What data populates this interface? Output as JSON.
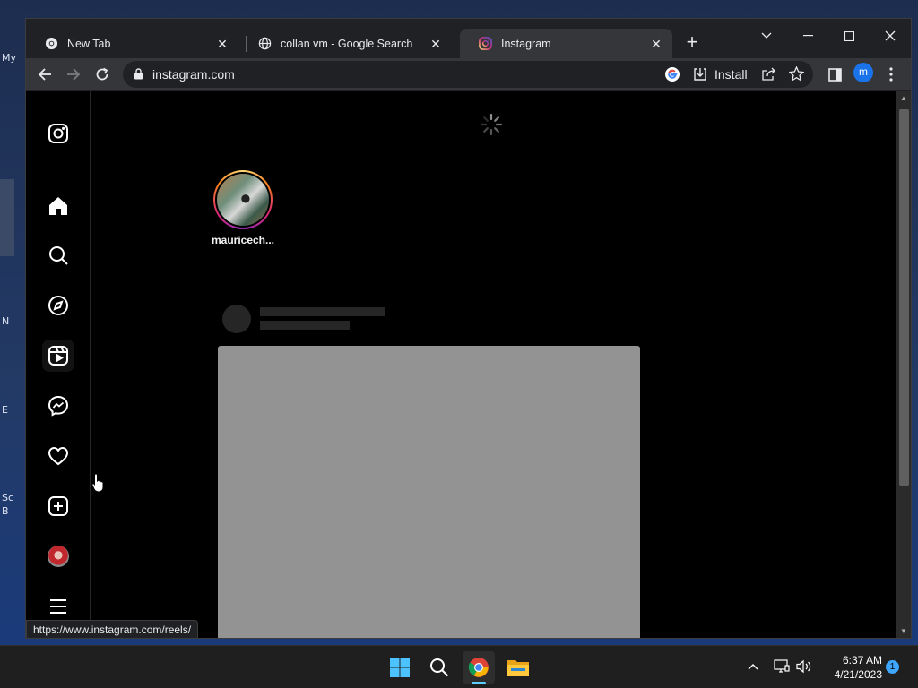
{
  "desktop": {
    "edge_labels": [
      "My",
      "N",
      "E",
      "Sc",
      "B"
    ]
  },
  "browser": {
    "tabs": [
      {
        "title": "New Tab",
        "icon": "chrome-icon",
        "active": false
      },
      {
        "title": "collan vm - Google Search",
        "icon": "globe-icon",
        "active": false
      },
      {
        "title": "Instagram",
        "icon": "instagram-icon",
        "active": true
      }
    ],
    "address": "instagram.com",
    "install_label": "Install",
    "profile_initial": "m",
    "status_url": "https://www.instagram.com/reels/"
  },
  "instagram": {
    "sidebar": [
      {
        "name": "instagram-logo-icon"
      },
      {
        "name": "home-icon"
      },
      {
        "name": "search-icon"
      },
      {
        "name": "explore-compass-icon"
      },
      {
        "name": "reels-icon"
      },
      {
        "name": "messenger-icon"
      },
      {
        "name": "notifications-heart-icon"
      },
      {
        "name": "create-plus-icon"
      },
      {
        "name": "profile-avatar"
      },
      {
        "name": "more-menu-icon"
      }
    ],
    "story": {
      "username": "mauricech..."
    }
  },
  "taskbar": {
    "time": "6:37 AM",
    "date": "4/21/2023",
    "notification_count": "1"
  },
  "colors": {
    "accent": "#1a73e8",
    "taskbar_indicator": "#60cdff",
    "skeleton_media": "#939393"
  }
}
